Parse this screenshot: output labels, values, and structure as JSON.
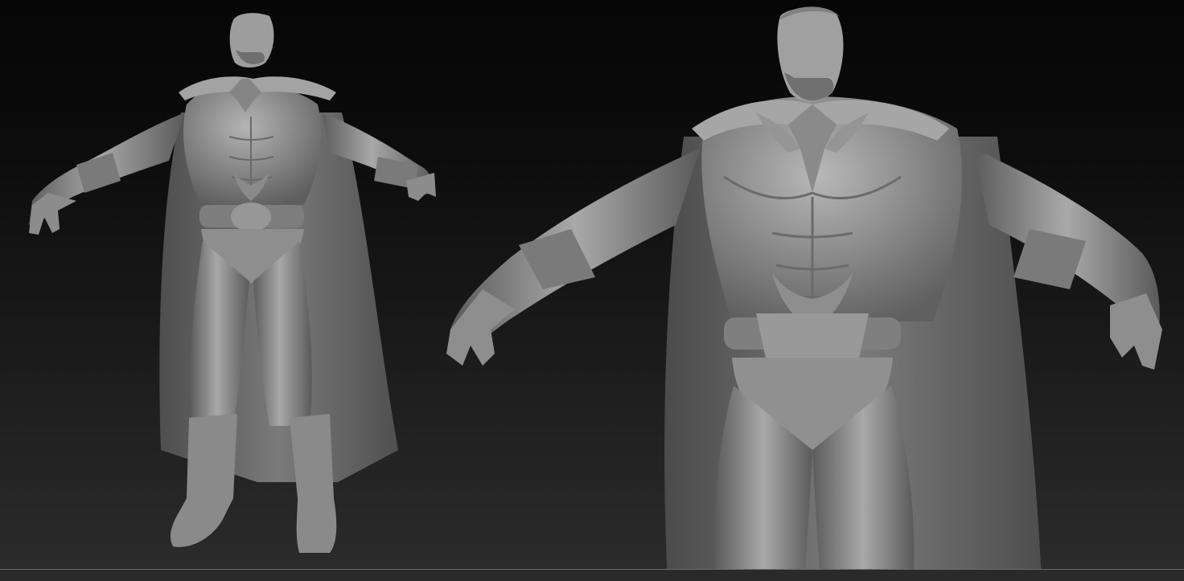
{
  "canvas": {
    "background_top": "#060606",
    "background_bottom": "#2c2c2c",
    "clay_color": "#9a9a9a"
  },
  "models": [
    {
      "id": "full-body-view",
      "icon": "sculpt-figure-full-body"
    },
    {
      "id": "close-up-view",
      "icon": "sculpt-figure-torso-closeup"
    }
  ]
}
